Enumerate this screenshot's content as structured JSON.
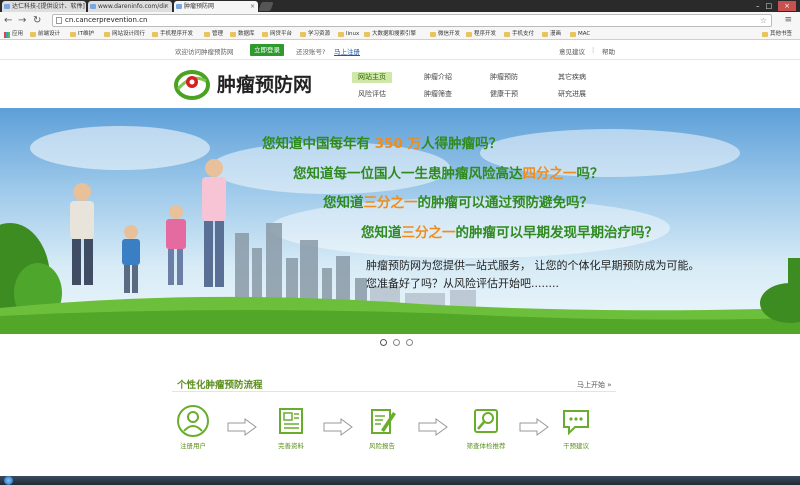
{
  "browser": {
    "tabs": [
      {
        "label": "达仁科技-[提供设计、软件]",
        "active": false
      },
      {
        "label": "www.dareninfo.com/dir",
        "active": false
      },
      {
        "label": "肿瘤预防网",
        "active": true
      }
    ],
    "url": "cn.cancerprevention.cn",
    "bookmarks": [
      "应用",
      "前端设计",
      "IT维护",
      "网站设计同行",
      "手机程序开发",
      "管理",
      "数据库",
      "网贷平台",
      "学习资源",
      "linux",
      "大数据和搜索引擎",
      "微信开发",
      "程序开发",
      "手机支付",
      "漫画",
      "MAC",
      "其他书签"
    ]
  },
  "topbar": {
    "welcome": "欢迎访问肿瘤预防网",
    "login": "立即登录",
    "no_account": "还没账号?",
    "register": "马上注册",
    "feedback": "意见建议",
    "separator": "|",
    "help": "帮助"
  },
  "logo": {
    "text": "肿瘤预防网",
    "accent": "#4aa320"
  },
  "nav": [
    {
      "label": "网站主页",
      "current": true
    },
    {
      "label": "肿瘤介绍",
      "current": false
    },
    {
      "label": "肿瘤预防",
      "current": false
    },
    {
      "label": "其它疾病",
      "current": false
    },
    {
      "label": "风险评估",
      "current": false
    },
    {
      "label": "肿瘤筛查",
      "current": false
    },
    {
      "label": "健康干预",
      "current": false
    },
    {
      "label": "研究进展",
      "current": false
    }
  ],
  "hero": {
    "q1": {
      "pre": "您知道中国每年有 ",
      "hl": "350 万",
      "post": "人得肿瘤吗？"
    },
    "q2": {
      "pre": "您知道每一位国人一生患肿瘤风险高达",
      "hl": "四分之一",
      "post": "吗？"
    },
    "q3": {
      "pre": "您知道",
      "hl": "三分之一",
      "post": "的肿瘤可以通过预防避免吗？"
    },
    "q4": {
      "pre": "您知道",
      "hl": "三分之一",
      "post": "的肿瘤可以早期发现早期治疗吗？"
    },
    "pitch1": "肿瘤预防网为您提供一站式服务， 让您的个体化早期预防成为可能。",
    "pitch2": "您准备好了吗？从风险评估开始吧........",
    "slides": 3,
    "active_slide": 1
  },
  "process": {
    "title": "个性化肿瘤预防流程",
    "start_link": "马上开始 »",
    "steps": [
      "注册用户",
      "完善资料",
      "风险报告",
      "筛查体检推荐",
      "干预建议"
    ]
  }
}
